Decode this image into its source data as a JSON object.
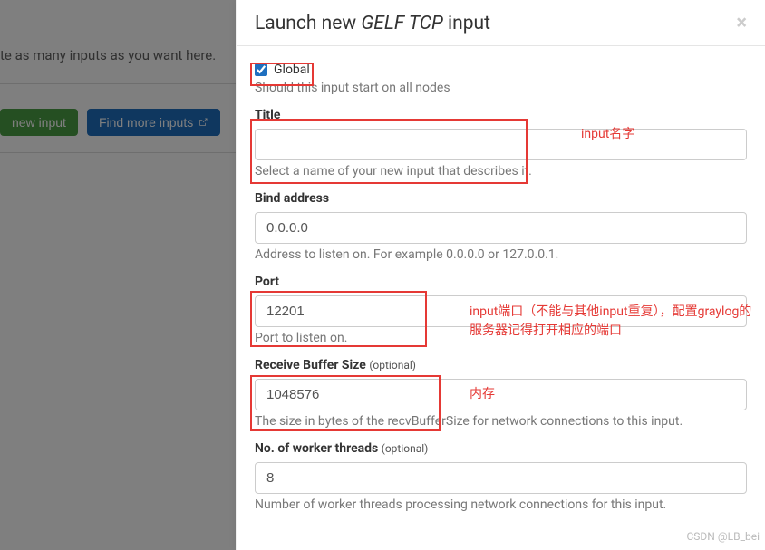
{
  "background": {
    "text": "te as many inputs as you want here.",
    "new_input_btn": "new input",
    "find_more_btn": "Find more inputs"
  },
  "modal": {
    "title_prefix": "Launch new ",
    "title_em": "GELF TCP",
    "title_suffix": " input",
    "close": "×"
  },
  "global": {
    "label": "Global",
    "checked": true,
    "help": "Should this input start on all nodes"
  },
  "title_field": {
    "label": "Title",
    "value": "",
    "help": "Select a name of your new input that describes it."
  },
  "bind": {
    "label": "Bind address",
    "value": "0.0.0.0",
    "help": "Address to listen on. For example 0.0.0.0 or 127.0.0.1."
  },
  "port": {
    "label": "Port",
    "value": "12201",
    "help": "Port to listen on."
  },
  "recv": {
    "label": "Receive Buffer Size ",
    "optional": "(optional)",
    "value": "1048576",
    "help": "The size in bytes of the recvBufferSize for network connections to this input."
  },
  "workers": {
    "label": "No. of worker threads ",
    "optional": "(optional)",
    "value": "8",
    "help": "Number of worker threads processing network connections for this input."
  },
  "annotations": {
    "name": "input名字",
    "port": "input端口（不能与其他input重复），配置graylog的服务器记得打开相应的端口",
    "mem": "内存"
  },
  "watermark": "CSDN @LB_bei"
}
